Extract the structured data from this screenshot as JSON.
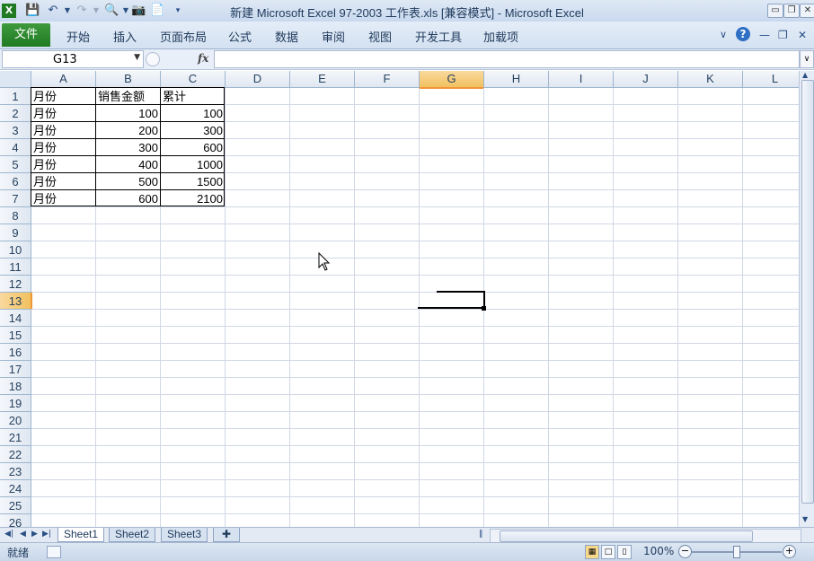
{
  "window": {
    "title": "新建 Microsoft Excel 97-2003 工作表.xls [兼容模式] - Microsoft Excel",
    "minimize": "▭",
    "restore": "❐",
    "close": "✕"
  },
  "quick_access": {
    "icons": [
      "excel-logo-icon",
      "save-icon",
      "undo-icon",
      "redo-icon",
      "print-preview-icon",
      "camera-icon",
      "document-icon",
      "customize-icon"
    ]
  },
  "ribbon": {
    "file": "文件",
    "tabs": [
      "开始",
      "插入",
      "页面布局",
      "公式",
      "数据",
      "审阅",
      "视图",
      "开发工具",
      "加载项"
    ]
  },
  "formula_bar": {
    "name_box": "G13",
    "fx": "fx",
    "content": ""
  },
  "columns": [
    "A",
    "B",
    "C",
    "D",
    "E",
    "F",
    "G",
    "H",
    "I",
    "J",
    "K",
    "L"
  ],
  "rows": [
    "1",
    "2",
    "3",
    "4",
    "5",
    "6",
    "7",
    "8",
    "9",
    "10",
    "11",
    "12",
    "13",
    "14",
    "15",
    "16",
    "17",
    "18",
    "19",
    "20",
    "21",
    "22",
    "23",
    "24",
    "25",
    "26"
  ],
  "selected": {
    "column": "G",
    "row": "13"
  },
  "table": {
    "headers": [
      "月份",
      "销售金额",
      "累计"
    ],
    "rows": [
      [
        "月份",
        "100",
        "100"
      ],
      [
        "月份",
        "200",
        "300"
      ],
      [
        "月份",
        "300",
        "600"
      ],
      [
        "月份",
        "400",
        "1000"
      ],
      [
        "月份",
        "500",
        "1500"
      ],
      [
        "月份",
        "600",
        "2100"
      ]
    ]
  },
  "sheets": {
    "tabs": [
      "Sheet1",
      "Sheet2",
      "Sheet3"
    ],
    "active": "Sheet1"
  },
  "status": {
    "text": "就绪",
    "zoom": "100%"
  },
  "colors": {
    "file_tab": "#2e8a30",
    "selection_header": "#f1c15f",
    "gridline": "#d0d7e5"
  }
}
